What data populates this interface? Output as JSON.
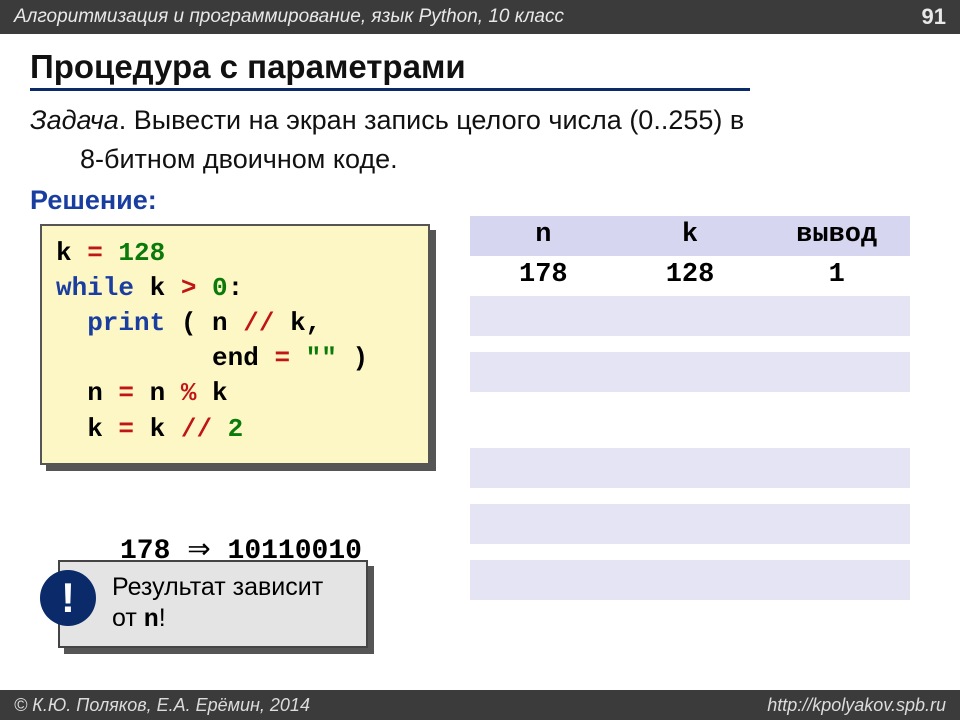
{
  "header": {
    "course": "Алгоритмизация и программирование, язык Python, 10 класс",
    "page": "91"
  },
  "title": "Процедура с параметрами",
  "task": {
    "label": "Задача",
    "text1": ". Вывести на экран запись целого числа (0..255) в",
    "text2": "8-битном двоичном коде."
  },
  "solution_label": "Решение:",
  "code": {
    "l1a": "k",
    "l1b": " = ",
    "l1c": "128",
    "l2a": "while",
    "l2b": " k",
    "l2c": " > ",
    "l2d": "0",
    "l2e": ":",
    "l3a": "  print",
    "l3b": " ( n",
    "l3c": " // ",
    "l3d": "k,",
    "l4a": "          end",
    "l4b": " = ",
    "l4c": "\"\"",
    "l4d": " )",
    "l5a": "  n",
    "l5b": " = ",
    "l5c": "n",
    "l5d": " % ",
    "l5e": "k",
    "l6a": "  k",
    "l6b": " = ",
    "l6c": "k",
    "l6d": " // ",
    "l6e": "2"
  },
  "trace": {
    "cols": [
      "n",
      "k",
      "вывод"
    ],
    "rows": [
      [
        "178",
        "128",
        "1"
      ],
      [
        "",
        "",
        ""
      ],
      [
        "",
        "",
        ""
      ],
      [
        "",
        "",
        ""
      ],
      [
        "",
        "",
        ""
      ],
      [
        "",
        "",
        ""
      ],
      [
        "",
        "",
        ""
      ]
    ]
  },
  "conversion": {
    "input": "178",
    "arrow": "⇒",
    "output": "10110010"
  },
  "result_box": {
    "bang": "!",
    "text1": "Результат зависит",
    "text2a": "от ",
    "text2b": "n",
    "text2c": "!"
  },
  "footer": {
    "left": "© К.Ю. Поляков, Е.А. Ерёмин, 2014",
    "right": "http://kpolyakov.spb.ru"
  }
}
